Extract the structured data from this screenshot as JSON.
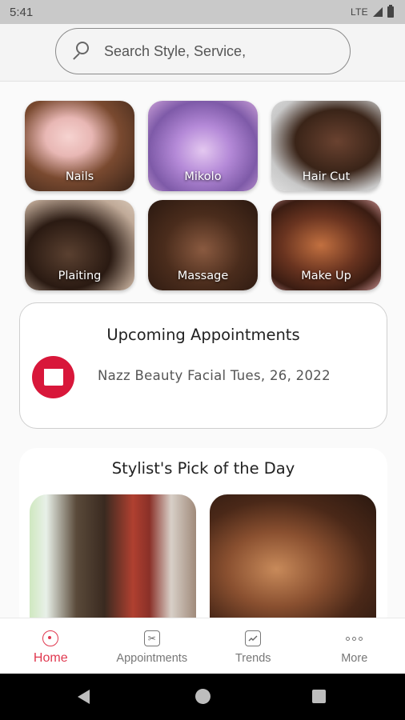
{
  "status_bar": {
    "time": "5:41",
    "network": "LTE"
  },
  "search": {
    "placeholder": "Search Style, Service,"
  },
  "categories": [
    {
      "label": "Nails"
    },
    {
      "label": "Mikolo"
    },
    {
      "label": "Hair Cut"
    },
    {
      "label": "Plaiting"
    },
    {
      "label": "Massage"
    },
    {
      "label": "Make Up"
    }
  ],
  "upcoming": {
    "title": "Upcoming Appointments",
    "detail": "Nazz Beauty Facial Tues, 26, 2022"
  },
  "stylist_pick": {
    "title": "Stylist's Pick of the Day"
  },
  "bottom_nav": [
    {
      "label": "Home",
      "icon": "home-icon",
      "active": true
    },
    {
      "label": "Appointments",
      "icon": "scissors-icon"
    },
    {
      "label": "Trends",
      "icon": "trend-icon"
    },
    {
      "label": "More",
      "icon": "more-icon"
    }
  ],
  "colors": {
    "accent": "#d8173a",
    "nav_active": "#e0384f"
  }
}
